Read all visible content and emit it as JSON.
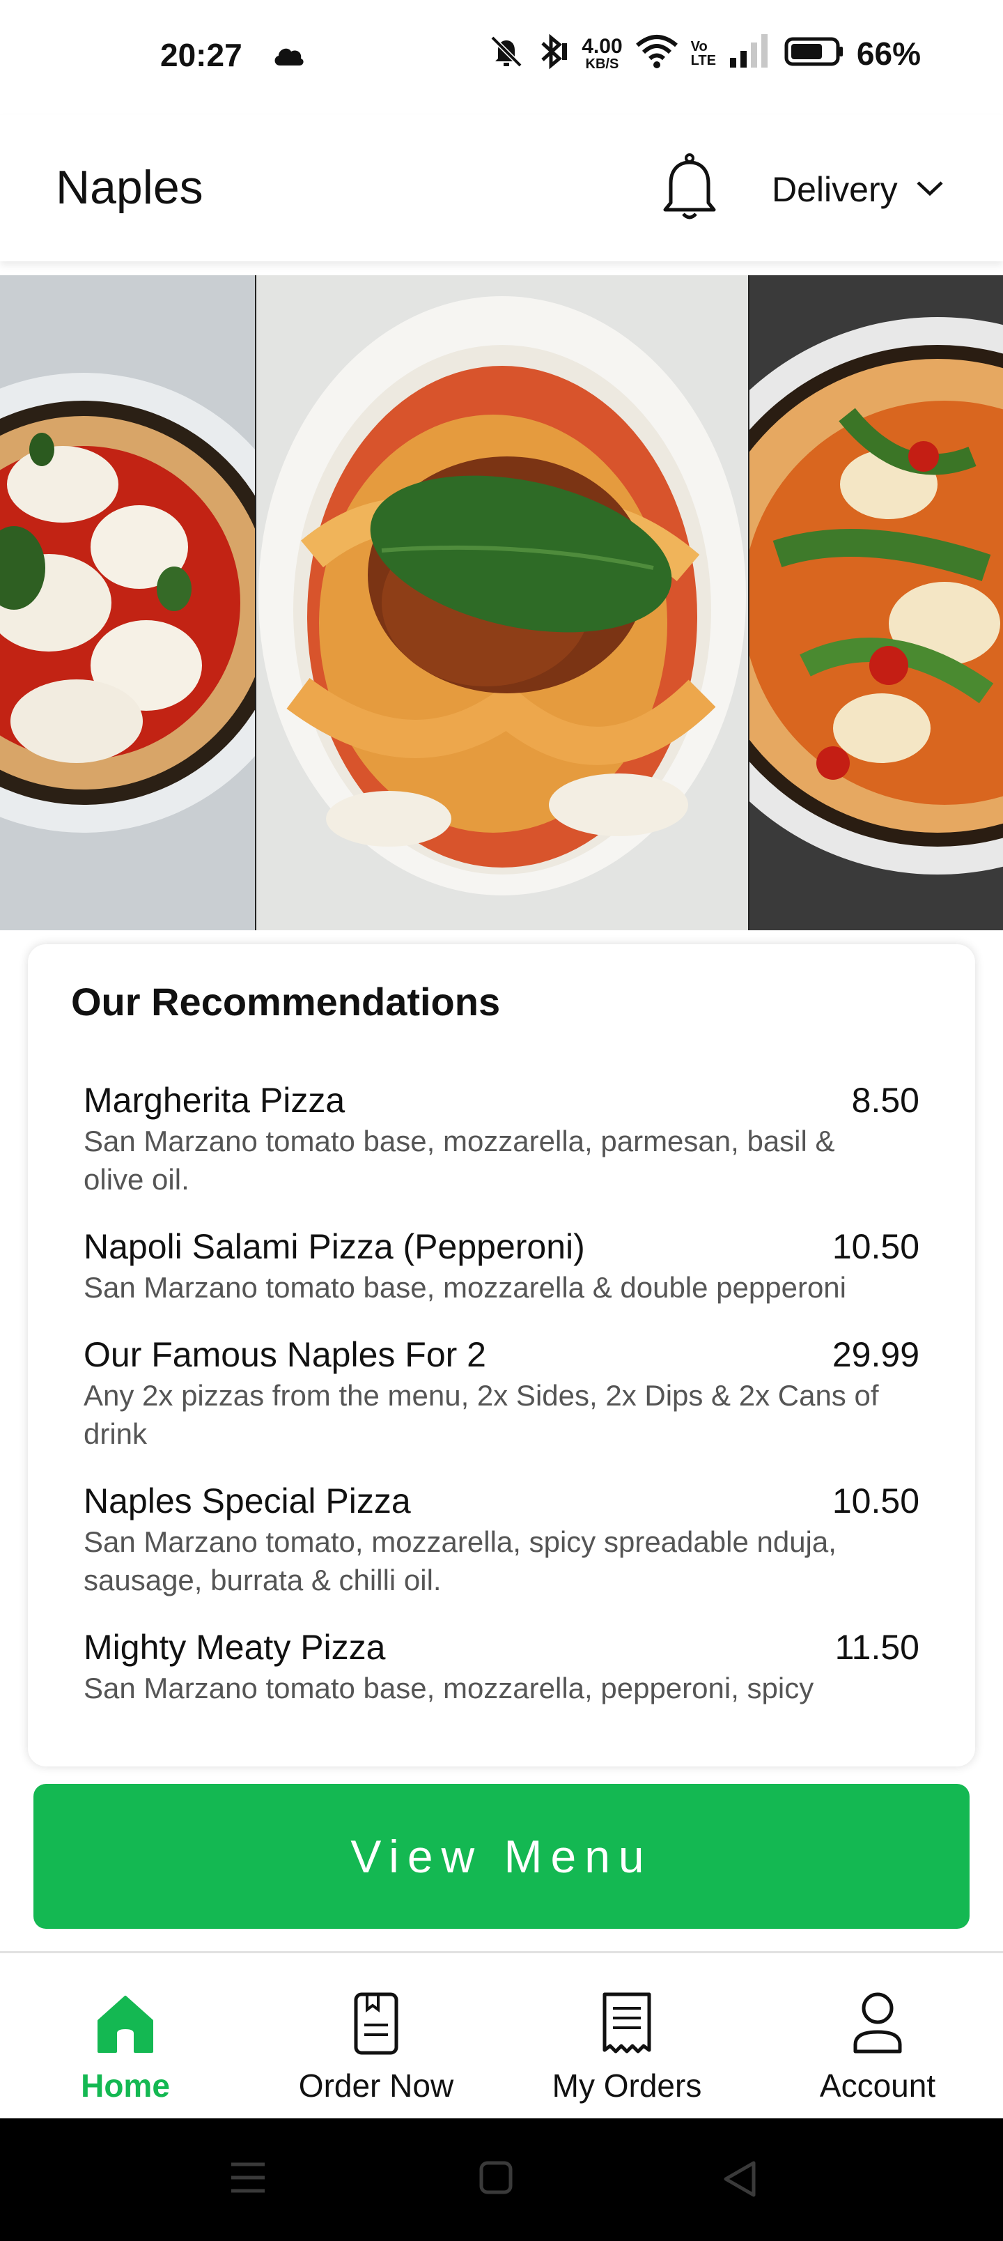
{
  "status_bar": {
    "time": "20:27",
    "net_speed_value": "4.00",
    "net_speed_unit": "KB/S",
    "volte_top": "Vo",
    "volte_bottom": "LTE",
    "battery_pct": "66%"
  },
  "header": {
    "title": "Naples",
    "mode_label": "Delivery"
  },
  "recommendations": {
    "heading": "Our Recommendations",
    "items": [
      {
        "name": "Margherita Pizza",
        "price": "8.50",
        "desc": "San Marzano tomato base, mozzarella, parmesan, basil & olive oil."
      },
      {
        "name": "Napoli Salami Pizza (Pepperoni)",
        "price": "10.50",
        "desc": "San Marzano tomato base, mozzarella & double pepperoni"
      },
      {
        "name": "Our Famous Naples For 2",
        "price": "29.99",
        "desc": "Any 2x pizzas from the menu, 2x Sides, 2x Dips & 2x Cans of drink"
      },
      {
        "name": "Naples Special Pizza",
        "price": "10.50",
        "desc": "San Marzano tomato, mozzarella, spicy spreadable nduja, sausage, burrata & chilli oil."
      },
      {
        "name": "Mighty Meaty Pizza",
        "price": "11.50",
        "desc": "San Marzano tomato base, mozzarella, pepperoni, spicy"
      }
    ]
  },
  "view_menu_label": "View Menu",
  "bottom_nav": {
    "items": [
      {
        "label": "Home",
        "icon": "home-icon",
        "active": true
      },
      {
        "label": "Order Now",
        "icon": "order-icon",
        "active": false
      },
      {
        "label": "My Orders",
        "icon": "receipt-icon",
        "active": false
      },
      {
        "label": "Account",
        "icon": "account-icon",
        "active": false
      }
    ]
  },
  "colors": {
    "accent": "#14b852",
    "text": "#111111",
    "muted": "#555555"
  }
}
